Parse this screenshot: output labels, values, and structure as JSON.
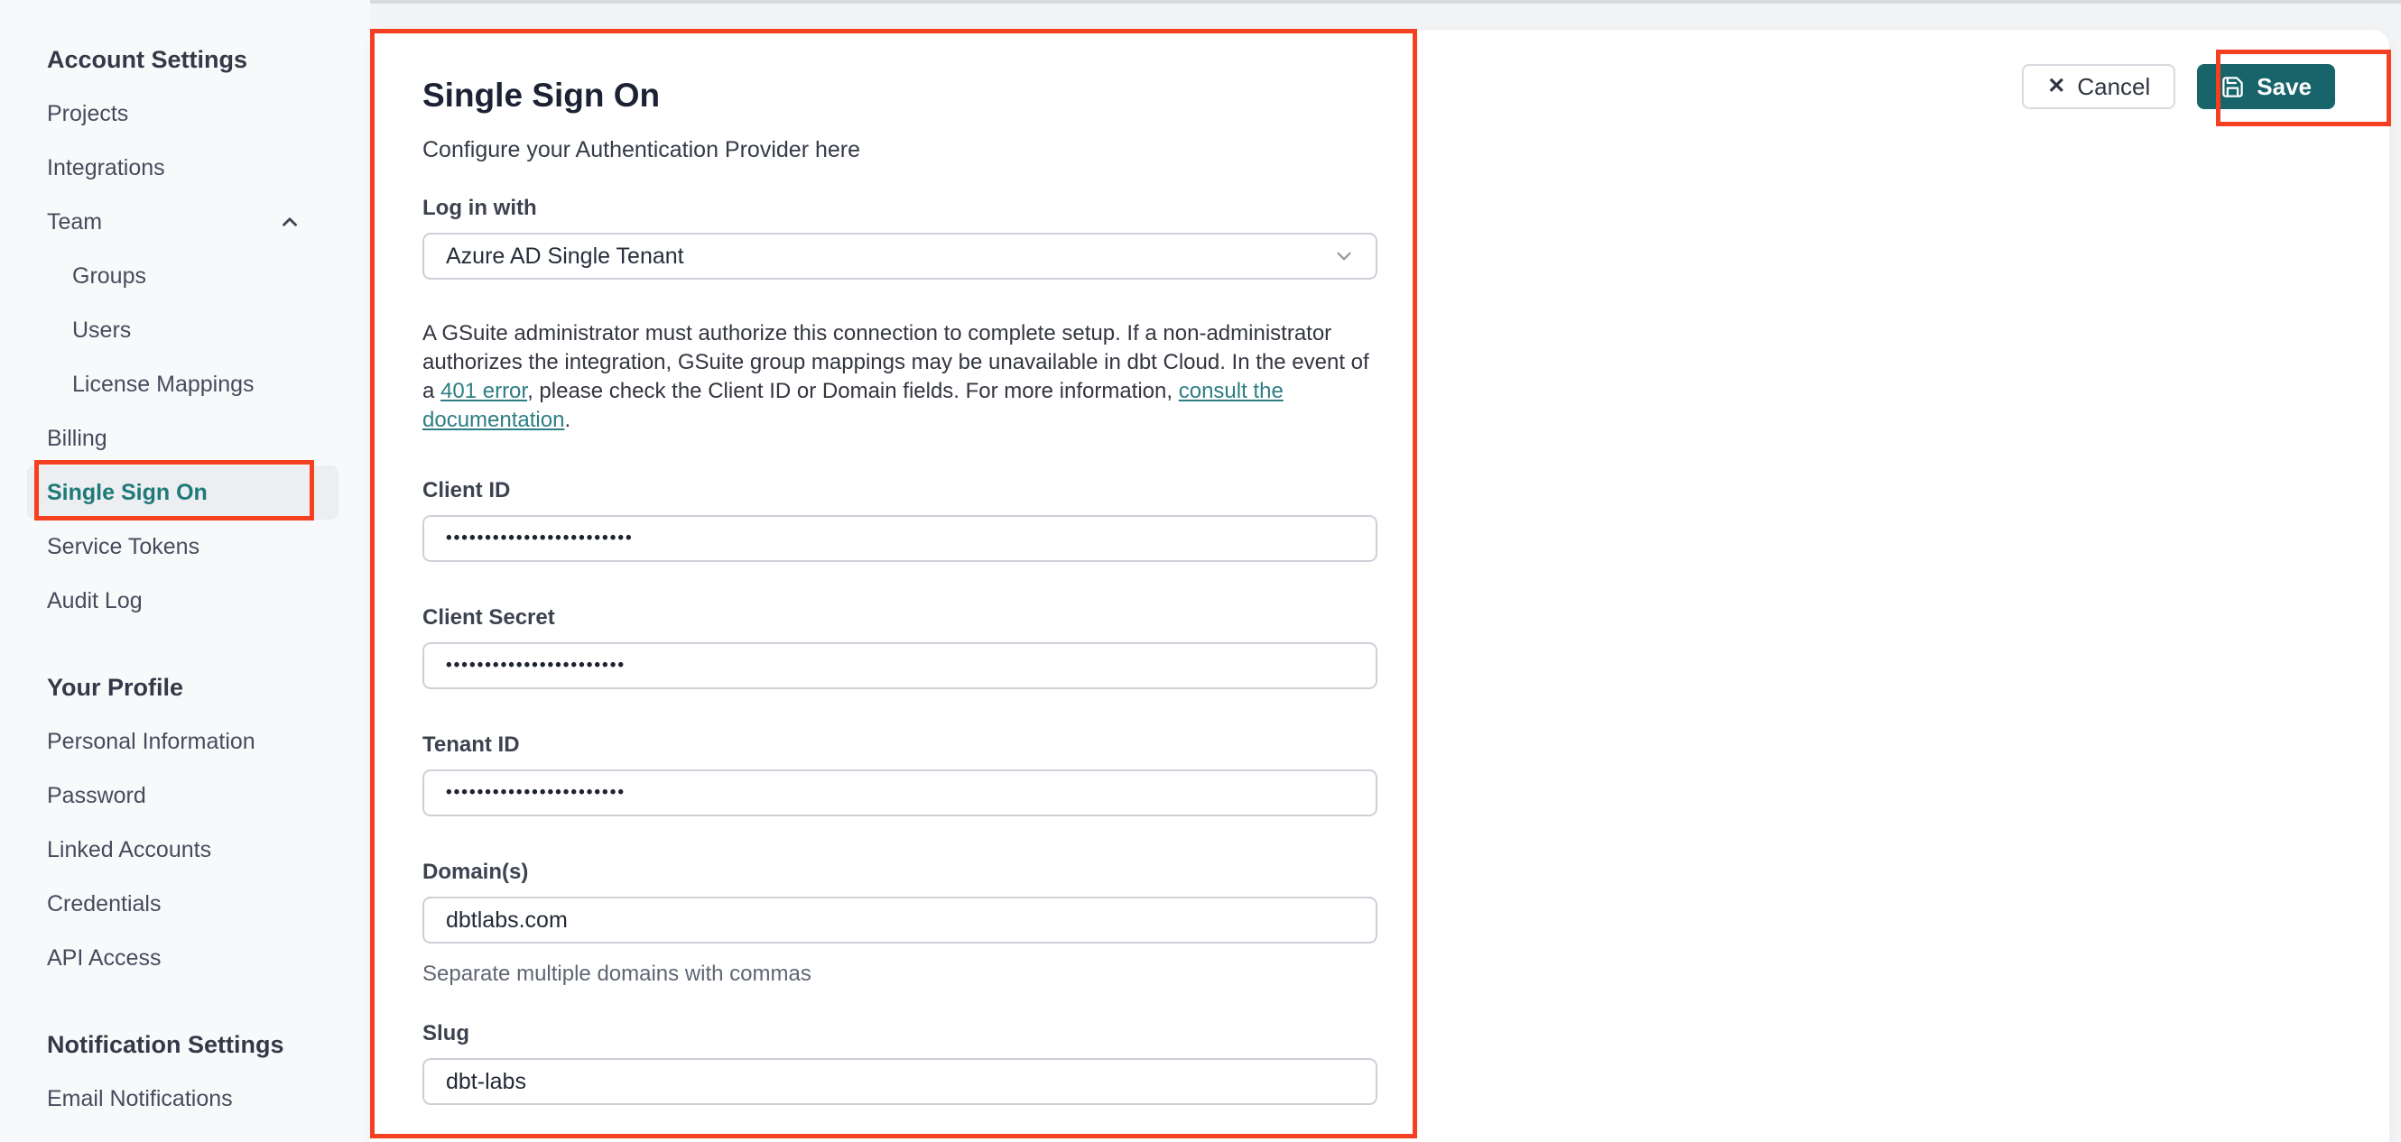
{
  "colors": {
    "accent_teal": "#1E7A78",
    "link_teal": "#2D7E84",
    "save_button_bg": "#17646B",
    "annotation_red": "#F43F20",
    "sidebar_bg": "#F8F9FB",
    "card_bg": "#FFFFFF"
  },
  "icons": {
    "close": "✕",
    "chevron_up": "chevron-up",
    "chevron_down": "chevron-down",
    "save": "floppy-disk"
  },
  "sidebar": {
    "sections": [
      {
        "header": "Account Settings",
        "items": [
          {
            "label": "Projects"
          },
          {
            "label": "Integrations"
          },
          {
            "label": "Team"
          },
          {
            "label": "Groups"
          },
          {
            "label": "Users"
          },
          {
            "label": "License Mappings"
          },
          {
            "label": "Billing"
          },
          {
            "label": "Single Sign On"
          },
          {
            "label": "Service Tokens"
          },
          {
            "label": "Audit Log"
          }
        ]
      },
      {
        "header": "Your Profile",
        "items": [
          {
            "label": "Personal Information"
          },
          {
            "label": "Password"
          },
          {
            "label": "Linked Accounts"
          },
          {
            "label": "Credentials"
          },
          {
            "label": "API Access"
          }
        ]
      },
      {
        "header": "Notification Settings",
        "items": [
          {
            "label": "Email Notifications"
          }
        ]
      }
    ]
  },
  "header": {
    "title": "Single Sign On",
    "subtitle": "Configure your Authentication Provider here",
    "cancel_label": "Cancel",
    "save_label": "Save"
  },
  "form": {
    "login_with": {
      "label": "Log in with",
      "selected": "Azure AD Single Tenant"
    },
    "notice": {
      "part1": "A GSuite administrator must authorize this connection to complete setup. If a non-administrator authorizes the integration, GSuite group mappings may be unavailable in dbt Cloud. In the event of a ",
      "link_401": "401 error",
      "part2": ", please check the Client ID or Domain fields. For more information, ",
      "link_docs": "consult the documentation",
      "part3": "."
    },
    "client_id": {
      "label": "Client ID",
      "value": "••••••••••••••••••••••••"
    },
    "client_secret": {
      "label": "Client Secret",
      "value": "•••••••••••••••••••••••"
    },
    "tenant_id": {
      "label": "Tenant ID",
      "value": "•••••••••••••••••••••••"
    },
    "domains": {
      "label": "Domain(s)",
      "value": "dbtlabs.com",
      "helper": "Separate multiple domains with commas"
    },
    "slug": {
      "label": "Slug",
      "value": "dbt-labs"
    }
  }
}
